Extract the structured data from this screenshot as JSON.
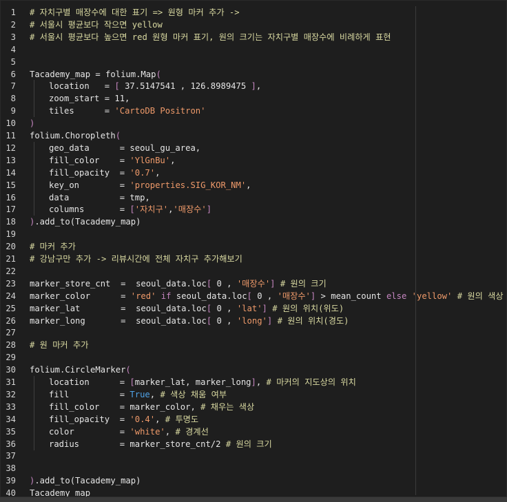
{
  "editor": {
    "lines": [
      {
        "num": "1",
        "indent": 0,
        "tokens": [
          {
            "t": "# 자치구별 매장수에 대한 표기 => 원형 마커 추가 ->",
            "c": "comment"
          }
        ]
      },
      {
        "num": "2",
        "indent": 0,
        "tokens": [
          {
            "t": "# 서울시 평균보다 작으면 yellow",
            "c": "comment"
          }
        ]
      },
      {
        "num": "3",
        "indent": 0,
        "tokens": [
          {
            "t": "# 서울시 평균보다 높으면 red 원형 마커 표기, 원의 크기는 자치구별 매장수에 비례하게 표현",
            "c": "comment"
          }
        ]
      },
      {
        "num": "4",
        "indent": 0,
        "tokens": []
      },
      {
        "num": "5",
        "indent": 0,
        "tokens": []
      },
      {
        "num": "6",
        "indent": 0,
        "tokens": [
          {
            "t": "Tacademy_map = folium.Map",
            "c": "default"
          },
          {
            "t": "(",
            "c": "keyword"
          }
        ]
      },
      {
        "num": "7",
        "indent": 1,
        "tokens": [
          {
            "t": "location   = ",
            "c": "default"
          },
          {
            "t": "[",
            "c": "keyword"
          },
          {
            "t": " 37.5147541 , 126.8989475 ",
            "c": "default"
          },
          {
            "t": "]",
            "c": "keyword"
          },
          {
            "t": ",",
            "c": "default"
          }
        ]
      },
      {
        "num": "8",
        "indent": 1,
        "tokens": [
          {
            "t": "zoom_start = 11,",
            "c": "default"
          }
        ]
      },
      {
        "num": "9",
        "indent": 1,
        "tokens": [
          {
            "t": "tiles      = ",
            "c": "default"
          },
          {
            "t": "'CartoDB Positron'",
            "c": "string"
          }
        ]
      },
      {
        "num": "10",
        "indent": 0,
        "tokens": [
          {
            "t": ")",
            "c": "keyword"
          }
        ]
      },
      {
        "num": "11",
        "indent": 0,
        "tokens": [
          {
            "t": "folium.Choropleth",
            "c": "default"
          },
          {
            "t": "(",
            "c": "keyword"
          }
        ]
      },
      {
        "num": "12",
        "indent": 1,
        "tokens": [
          {
            "t": "geo_data      = seoul_gu_area,",
            "c": "default"
          }
        ]
      },
      {
        "num": "13",
        "indent": 1,
        "tokens": [
          {
            "t": "fill_color    = ",
            "c": "default"
          },
          {
            "t": "'YlGnBu'",
            "c": "string"
          },
          {
            "t": ",",
            "c": "default"
          }
        ]
      },
      {
        "num": "14",
        "indent": 1,
        "tokens": [
          {
            "t": "fill_opacity  = ",
            "c": "default"
          },
          {
            "t": "'0.7'",
            "c": "string"
          },
          {
            "t": ",",
            "c": "default"
          }
        ]
      },
      {
        "num": "15",
        "indent": 1,
        "tokens": [
          {
            "t": "key_on        = ",
            "c": "default"
          },
          {
            "t": "'properties.SIG_KOR_NM'",
            "c": "string"
          },
          {
            "t": ",",
            "c": "default"
          }
        ]
      },
      {
        "num": "16",
        "indent": 1,
        "tokens": [
          {
            "t": "data          = tmp,",
            "c": "default"
          }
        ]
      },
      {
        "num": "17",
        "indent": 1,
        "tokens": [
          {
            "t": "columns       = ",
            "c": "default"
          },
          {
            "t": "[",
            "c": "keyword"
          },
          {
            "t": "'자치구'",
            "c": "string"
          },
          {
            "t": ",",
            "c": "default"
          },
          {
            "t": "'매장수'",
            "c": "string"
          },
          {
            "t": "]",
            "c": "keyword"
          }
        ]
      },
      {
        "num": "18",
        "indent": 0,
        "tokens": [
          {
            "t": ")",
            "c": "keyword"
          },
          {
            "t": ".add_to(Tacademy_map)",
            "c": "default"
          }
        ]
      },
      {
        "num": "19",
        "indent": 0,
        "tokens": []
      },
      {
        "num": "20",
        "indent": 0,
        "tokens": [
          {
            "t": "# 마커 추가",
            "c": "comment"
          }
        ]
      },
      {
        "num": "21",
        "indent": 0,
        "tokens": [
          {
            "t": "# 강남구만 추가 -> 리뷰시간에 전체 자치구 추가해보기",
            "c": "comment"
          }
        ]
      },
      {
        "num": "22",
        "indent": 0,
        "tokens": []
      },
      {
        "num": "23",
        "indent": 0,
        "tokens": [
          {
            "t": "marker_store_cnt  =  seoul_data.loc",
            "c": "default"
          },
          {
            "t": "[",
            "c": "keyword"
          },
          {
            "t": " 0 , ",
            "c": "default"
          },
          {
            "t": "'매장수'",
            "c": "string"
          },
          {
            "t": "]",
            "c": "keyword"
          },
          {
            "t": " ",
            "c": "default"
          },
          {
            "t": "# 원의 크기",
            "c": "comment"
          }
        ]
      },
      {
        "num": "24",
        "indent": 0,
        "tokens": [
          {
            "t": "marker_color      = ",
            "c": "default"
          },
          {
            "t": "'red'",
            "c": "string"
          },
          {
            "t": " ",
            "c": "default"
          },
          {
            "t": "if",
            "c": "keyword"
          },
          {
            "t": " seoul_data.loc",
            "c": "default"
          },
          {
            "t": "[",
            "c": "keyword"
          },
          {
            "t": " 0 , ",
            "c": "default"
          },
          {
            "t": "'매장수'",
            "c": "string"
          },
          {
            "t": "]",
            "c": "keyword"
          },
          {
            "t": " > mean_count ",
            "c": "default"
          },
          {
            "t": "else",
            "c": "keyword"
          },
          {
            "t": " ",
            "c": "default"
          },
          {
            "t": "'yellow'",
            "c": "string"
          },
          {
            "t": " ",
            "c": "default"
          },
          {
            "t": "# 원의 색상",
            "c": "comment"
          }
        ]
      },
      {
        "num": "25",
        "indent": 0,
        "tokens": [
          {
            "t": "marker_lat        =  seoul_data.loc",
            "c": "default"
          },
          {
            "t": "[",
            "c": "keyword"
          },
          {
            "t": " 0 , ",
            "c": "default"
          },
          {
            "t": "'lat'",
            "c": "string"
          },
          {
            "t": "]",
            "c": "keyword"
          },
          {
            "t": " ",
            "c": "default"
          },
          {
            "t": "# 원의 위치(위도)",
            "c": "comment"
          }
        ]
      },
      {
        "num": "26",
        "indent": 0,
        "tokens": [
          {
            "t": "marker_long       =  seoul_data.loc",
            "c": "default"
          },
          {
            "t": "[",
            "c": "keyword"
          },
          {
            "t": " 0 , ",
            "c": "default"
          },
          {
            "t": "'long'",
            "c": "string"
          },
          {
            "t": "]",
            "c": "keyword"
          },
          {
            "t": " ",
            "c": "default"
          },
          {
            "t": "# 원의 위치(경도)",
            "c": "comment"
          }
        ]
      },
      {
        "num": "27",
        "indent": 0,
        "tokens": []
      },
      {
        "num": "28",
        "indent": 0,
        "tokens": [
          {
            "t": "# 원 마커 추가",
            "c": "comment"
          }
        ]
      },
      {
        "num": "29",
        "indent": 0,
        "tokens": []
      },
      {
        "num": "30",
        "indent": 0,
        "tokens": [
          {
            "t": "folium.CircleMarker",
            "c": "default"
          },
          {
            "t": "(",
            "c": "keyword"
          }
        ]
      },
      {
        "num": "31",
        "indent": 1,
        "tokens": [
          {
            "t": "location      = ",
            "c": "default"
          },
          {
            "t": "[",
            "c": "keyword"
          },
          {
            "t": "marker_lat, marker_long",
            "c": "default"
          },
          {
            "t": "]",
            "c": "keyword"
          },
          {
            "t": ", ",
            "c": "default"
          },
          {
            "t": "# 마커의 지도상의 위치",
            "c": "comment"
          }
        ]
      },
      {
        "num": "32",
        "indent": 1,
        "tokens": [
          {
            "t": "fill          = ",
            "c": "default"
          },
          {
            "t": "True",
            "c": "builtin"
          },
          {
            "t": ", ",
            "c": "default"
          },
          {
            "t": "# 색상 채움 여부",
            "c": "comment"
          }
        ]
      },
      {
        "num": "33",
        "indent": 1,
        "tokens": [
          {
            "t": "fill_color    = marker_color, ",
            "c": "default"
          },
          {
            "t": "# 채우는 색상",
            "c": "comment"
          }
        ]
      },
      {
        "num": "34",
        "indent": 1,
        "tokens": [
          {
            "t": "fill_opacity  = ",
            "c": "default"
          },
          {
            "t": "'0.4'",
            "c": "string"
          },
          {
            "t": ", ",
            "c": "default"
          },
          {
            "t": "# 투명도",
            "c": "comment"
          }
        ]
      },
      {
        "num": "35",
        "indent": 1,
        "tokens": [
          {
            "t": "color         = ",
            "c": "default"
          },
          {
            "t": "'white'",
            "c": "string"
          },
          {
            "t": ", ",
            "c": "default"
          },
          {
            "t": "# 경계선",
            "c": "comment"
          }
        ]
      },
      {
        "num": "36",
        "indent": 1,
        "tokens": [
          {
            "t": "radius        = marker_store_cnt/2 ",
            "c": "default"
          },
          {
            "t": "# 원의 크기",
            "c": "comment"
          }
        ]
      },
      {
        "num": "37",
        "indent": 0,
        "tokens": []
      },
      {
        "num": "38",
        "indent": 0,
        "tokens": []
      },
      {
        "num": "39",
        "indent": 0,
        "tokens": [
          {
            "t": ")",
            "c": "keyword"
          },
          {
            "t": ".add_to(Tacademy_map)",
            "c": "default"
          }
        ]
      },
      {
        "num": "40",
        "indent": 0,
        "tokens": [
          {
            "t": "Tacademy_map",
            "c": "default"
          }
        ]
      }
    ]
  },
  "theme": {
    "background": "#1e1e1e",
    "comment": "#d8d8a0",
    "string": "#ef9a6a",
    "keyword": "#c586c0",
    "builtin": "#4fa3e8",
    "text": "#e6e6e6"
  }
}
